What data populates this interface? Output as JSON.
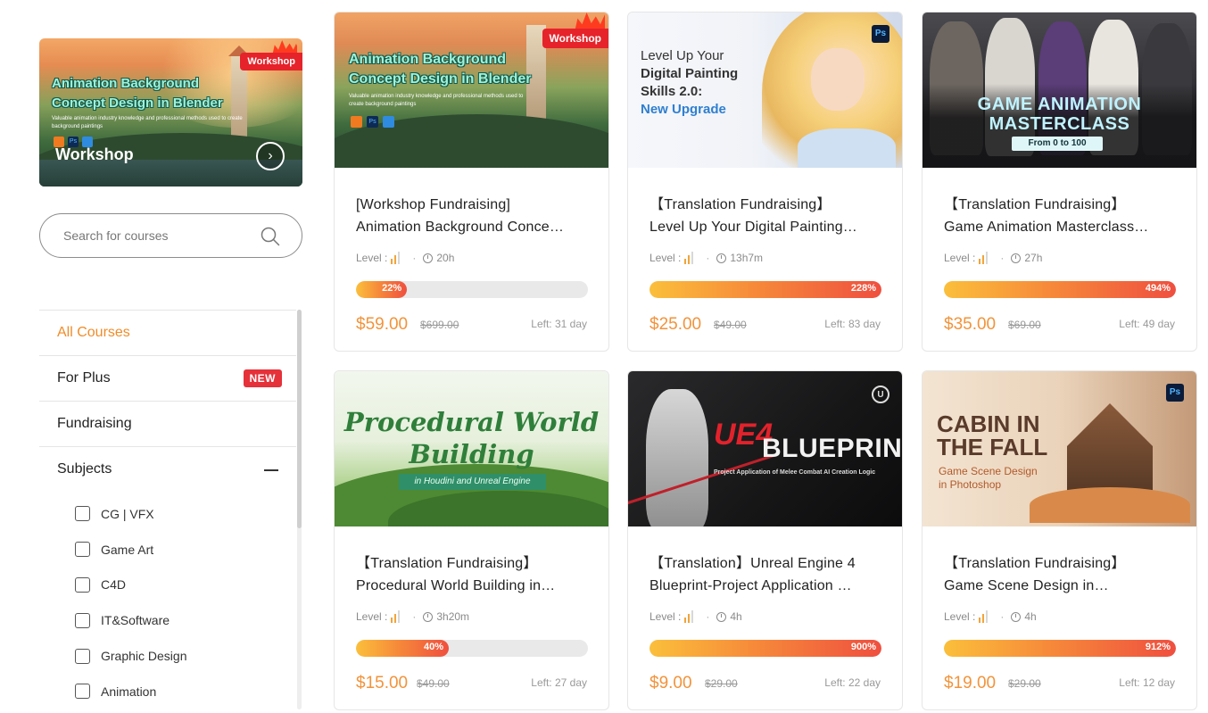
{
  "sidebar": {
    "promo": {
      "title": "Animation Background Concept Design in Blender",
      "subtitle": "Valuable animation industry knowledge and professional methods used to create background paintings",
      "big_label": "Workshop",
      "badge": "Workshop"
    },
    "search": {
      "placeholder": "Search for courses"
    },
    "nav": [
      {
        "label": "All Courses"
      },
      {
        "label": "For Plus",
        "badge": "NEW"
      },
      {
        "label": "Fundraising"
      },
      {
        "label": "Subjects"
      }
    ],
    "subjects": [
      "CG | VFX",
      "Game Art",
      "C4D",
      "IT&Software",
      "Graphic Design",
      "Animation"
    ]
  },
  "courses": [
    {
      "title_line1": "[Workshop Fundraising]",
      "title_line2": "Animation Background Conce…",
      "level_label": "Level :",
      "duration": "20h",
      "progress_label": "22%",
      "progress": 0.22,
      "price": "$59.00",
      "original_price": "$699.00",
      "time_left": "Left: 31 day",
      "thumb": {
        "badge": "Workshop",
        "title": "Animation Background Concept Design in Blender",
        "subtitle": "Valuable animation industry knowledge and professional methods used to create background paintings"
      }
    },
    {
      "title_line1": "【Translation Fundraising】",
      "title_line2": "Level Up Your Digital Painting…",
      "level_label": "Level :",
      "duration": "13h7m",
      "progress_label": "228%",
      "progress": 1,
      "price": "$25.00",
      "original_price": "$49.00",
      "time_left": "Left: 83 day",
      "thumb": {
        "title_a": "Level Up Your",
        "title_b": "Digital Painting",
        "title_c": "Skills 2.0:",
        "title_d": "New Upgrade",
        "icon": "Ps"
      }
    },
    {
      "title_line1": "【Translation Fundraising】",
      "title_line2": "Game Animation Masterclass…",
      "level_label": "Level :",
      "duration": "27h",
      "progress_label": "494%",
      "progress": 1,
      "price": "$35.00",
      "original_price": "$69.00",
      "time_left": "Left: 49 day",
      "thumb": {
        "title_a": "GAME ANIMATION",
        "title_b": "MASTERCLASS",
        "tag": "From 0 to 100"
      }
    },
    {
      "title_line1": "【Translation Fundraising】",
      "title_line2": "Procedural World Building in…",
      "level_label": "Level :",
      "duration": "3h20m",
      "progress_label": "40%",
      "progress": 0.4,
      "price": "$15.00",
      "original_price": "$49.00",
      "time_left": "Left: 27 day",
      "thumb": {
        "title_a": "Procedural World",
        "title_b": "Building",
        "tag": "in Houdini and Unreal Engine"
      }
    },
    {
      "title_line1": "【Translation】Unreal Engine 4",
      "title_line2": "Blueprint-Project Application …",
      "level_label": "Level :",
      "duration": "4h",
      "progress_label": "900%",
      "progress": 1,
      "price": "$9.00",
      "original_price": "$29.00",
      "time_left": "Left: 22 day",
      "thumb": {
        "title_a": "UE4",
        "title_b": "BLUEPRINT",
        "tag": "Project Application of Melee Combat AI Creation Logic"
      }
    },
    {
      "title_line1": "【Translation Fundraising】",
      "title_line2": "Game Scene Design in…",
      "level_label": "Level :",
      "duration": "4h",
      "progress_label": "912%",
      "progress": 1,
      "price": "$19.00",
      "original_price": "$29.00",
      "time_left": "Left: 12 day",
      "thumb": {
        "title_a": "CABIN IN",
        "title_b": "THE FALL",
        "sub_a": "Game Scene Design",
        "sub_b": "in Photoshop",
        "icon": "Ps"
      }
    }
  ]
}
